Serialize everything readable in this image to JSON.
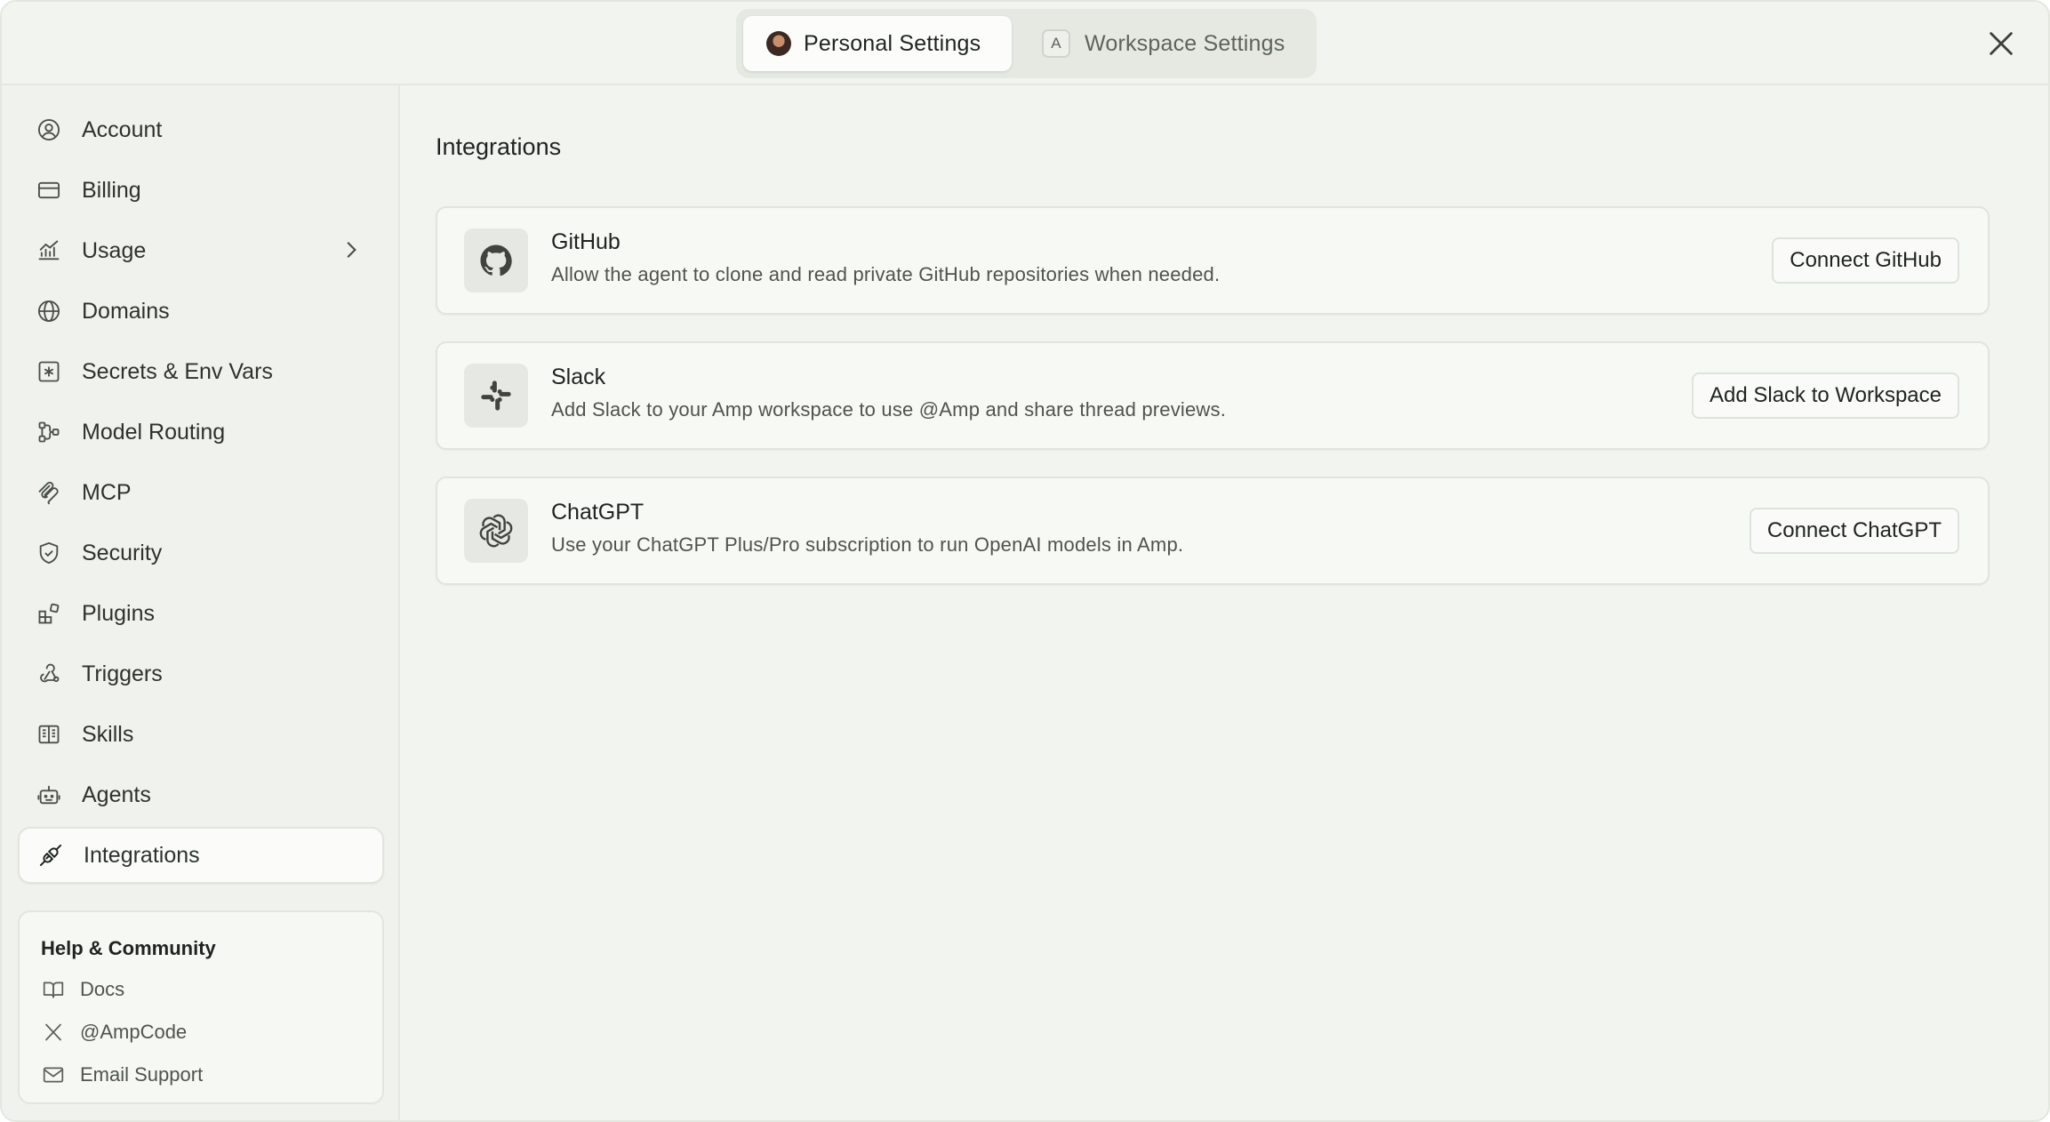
{
  "header": {
    "tabs": [
      {
        "label": "Personal Settings",
        "active": true
      },
      {
        "label": "Workspace Settings",
        "active": false,
        "badge": "A"
      }
    ]
  },
  "sidebar": {
    "items": [
      {
        "label": "Account",
        "icon": "user-circle-icon"
      },
      {
        "label": "Billing",
        "icon": "credit-card-icon"
      },
      {
        "label": "Usage",
        "icon": "chart-icon",
        "has_submenu": true
      },
      {
        "label": "Domains",
        "icon": "globe-icon"
      },
      {
        "label": "Secrets & Env Vars",
        "icon": "asterisk-square-icon"
      },
      {
        "label": "Model Routing",
        "icon": "routing-icon"
      },
      {
        "label": "MCP",
        "icon": "mcp-icon"
      },
      {
        "label": "Security",
        "icon": "shield-icon"
      },
      {
        "label": "Plugins",
        "icon": "puzzle-blocks-icon"
      },
      {
        "label": "Triggers",
        "icon": "webhook-icon"
      },
      {
        "label": "Skills",
        "icon": "book-open-icon"
      },
      {
        "label": "Agents",
        "icon": "robot-icon"
      },
      {
        "label": "Integrations",
        "icon": "plug-icon",
        "selected": true
      }
    ],
    "help": {
      "title": "Help & Community",
      "links": [
        {
          "label": "Docs",
          "icon": "book-icon"
        },
        {
          "label": "@AmpCode",
          "icon": "x-logo-icon"
        },
        {
          "label": "Email Support",
          "icon": "mail-icon"
        }
      ]
    }
  },
  "main": {
    "title": "Integrations",
    "cards": [
      {
        "name": "GitHub",
        "description": "Allow the agent to clone and read private GitHub repositories when needed.",
        "button": "Connect GitHub",
        "icon": "github-icon"
      },
      {
        "name": "Slack",
        "description": "Add Slack to your Amp workspace to use @Amp and share thread previews.",
        "button": "Add Slack to Workspace",
        "icon": "slack-icon"
      },
      {
        "name": "ChatGPT",
        "description": "Use your ChatGPT Plus/Pro subscription to run OpenAI models in Amp.",
        "button": "Connect ChatGPT",
        "icon": "openai-icon"
      }
    ]
  },
  "colors": {
    "background": "#f2f5ef",
    "card": "#f7f9f5",
    "text": "#1f2420",
    "muted": "#4e554d",
    "border": "#e1e5dd"
  }
}
